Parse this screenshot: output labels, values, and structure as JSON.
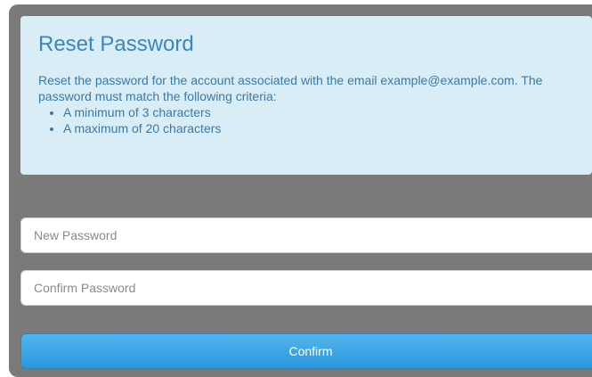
{
  "info": {
    "title": "Reset Password",
    "description": "Reset the password for the account associated with the email example@example.com. The password must match the following criteria:",
    "criteria": [
      "A minimum of 3 characters",
      "A maximum of 20 characters"
    ]
  },
  "form": {
    "new_password": {
      "placeholder": "New Password",
      "value": ""
    },
    "confirm_password": {
      "placeholder": "Confirm Password",
      "value": ""
    },
    "confirm_label": "Confirm"
  },
  "colors": {
    "panel_bg": "#7a7a7a",
    "info_bg": "#d9edf7",
    "info_text": "#3b79a6",
    "button_bg": "#2a97dc"
  }
}
